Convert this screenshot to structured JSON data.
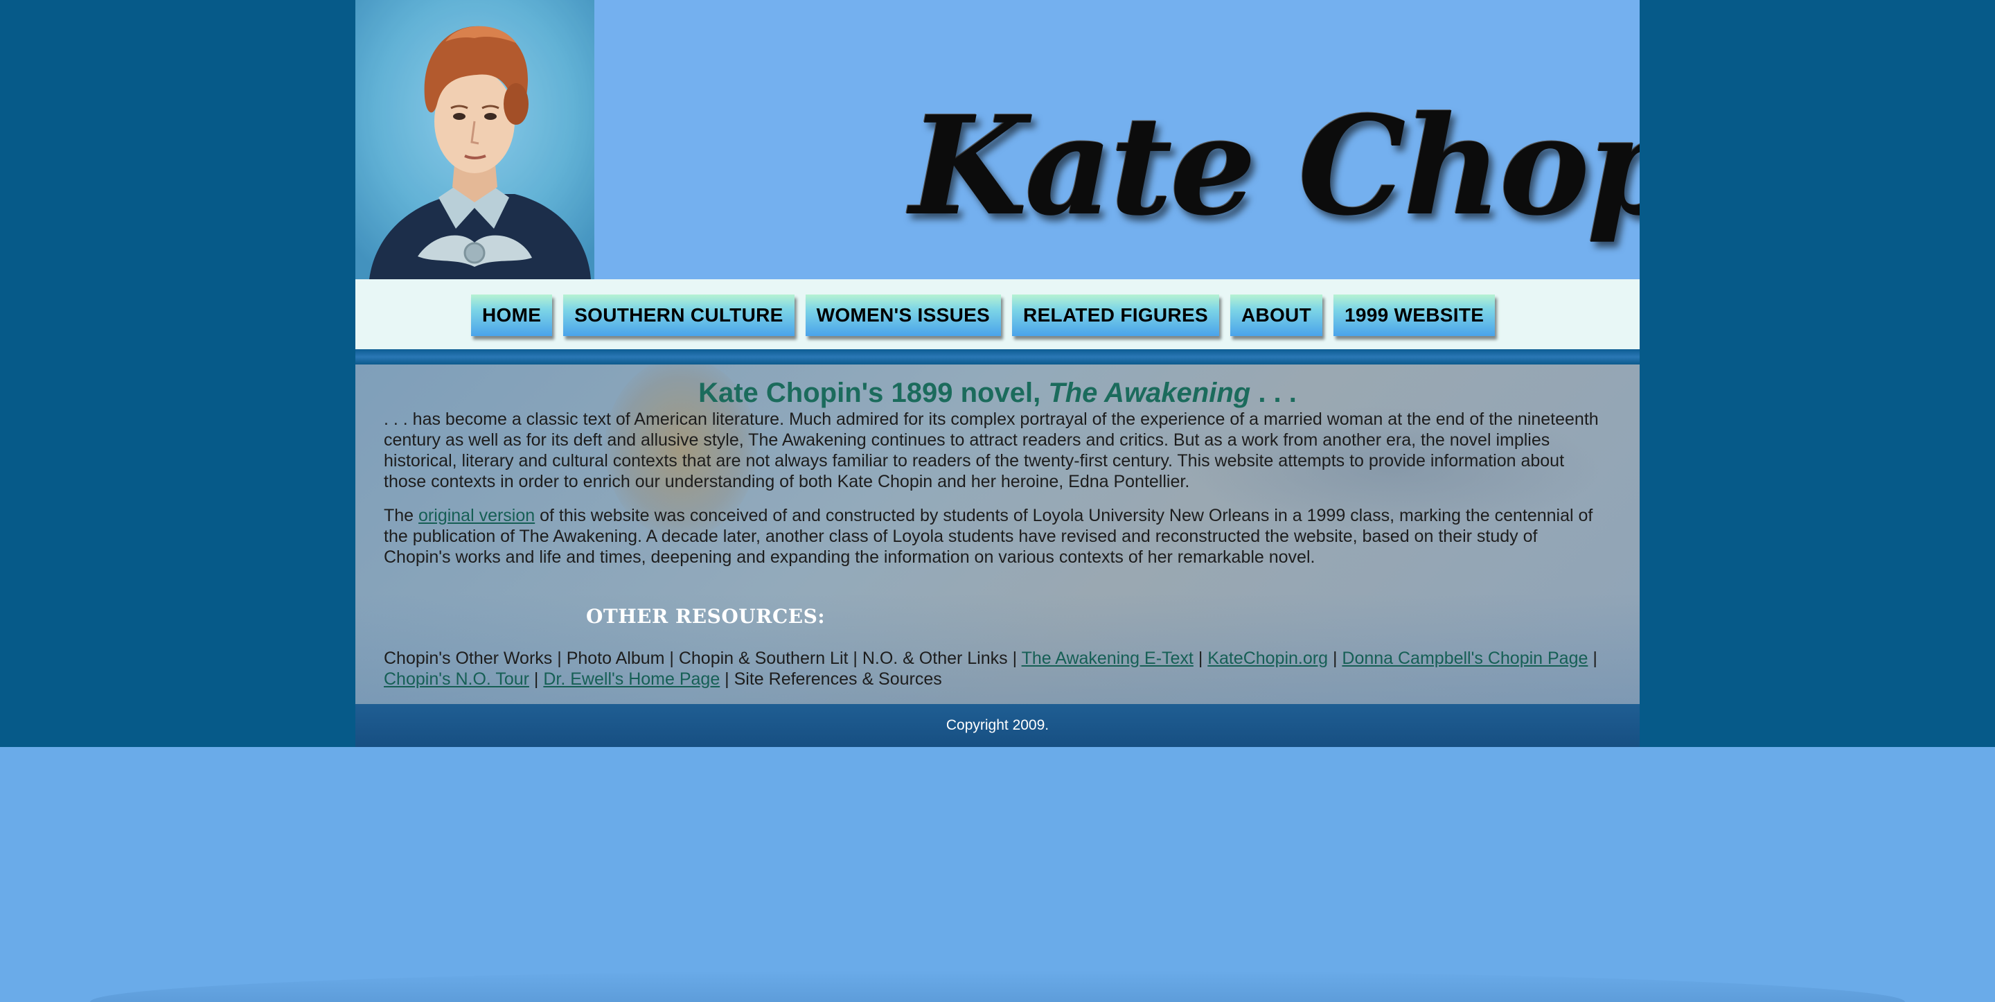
{
  "header": {
    "site_title": "Kate Chopin"
  },
  "nav": {
    "items": [
      {
        "label": "HOME"
      },
      {
        "label": "SOUTHERN CULTURE"
      },
      {
        "label": "WOMEN'S ISSUES"
      },
      {
        "label": "RELATED FIGURES"
      },
      {
        "label": "ABOUT"
      },
      {
        "label": "1999 WEBSITE"
      }
    ]
  },
  "main": {
    "headline_prefix": "Kate Chopin's 1899 novel, ",
    "headline_title": "The Awakening",
    "headline_suffix": " . . .",
    "paragraph1": ". . . has become a classic text of American literature. Much admired for its complex portrayal of the experience of a married woman at the end of the nineteenth century as well as for its deft and allusive style, The Awakening continues to attract readers and critics. But as a work from another era, the novel implies historical, literary and cultural contexts that are not always familiar to readers of the twenty-first century. This website attempts to provide information about those contexts in order to enrich our understanding of both Kate Chopin and her heroine, Edna Pontellier.",
    "paragraph2_before": "The ",
    "paragraph2_link": "original version",
    "paragraph2_after": " of this website was conceived of and constructed by students of Loyola University New Orleans in a 1999 class, marking the centennial of the publication of The Awakening. A decade later, another class of Loyola students have revised and reconstructed the website, based on their study of Chopin's works and life and times, deepening and expanding the information on various contexts of her remarkable novel.",
    "resources_heading": "OTHER RESOURCES:",
    "separator": " | ",
    "resources": [
      {
        "label": "Chopin's Other Works",
        "link": false
      },
      {
        "label": "Photo Album",
        "link": false
      },
      {
        "label": "Chopin & Southern Lit",
        "link": false
      },
      {
        "label": "N.O. & Other Links",
        "link": false
      },
      {
        "label": "The Awakening E-Text",
        "link": true
      },
      {
        "label": "KateChopin.org",
        "link": true
      },
      {
        "label": "Donna Campbell's Chopin Page",
        "link": true
      },
      {
        "label": "Chopin's N.O. Tour",
        "link": true
      },
      {
        "label": "Dr. Ewell's Home Page",
        "link": true
      },
      {
        "label": "Site References & Sources",
        "link": false
      }
    ]
  },
  "footer": {
    "copyright": "Copyright 2009."
  },
  "colors": {
    "outer_background": "#065a89",
    "lower_background": "#6aabe9",
    "header_background": "#74b0ef",
    "nav_background": "#e8f7f6",
    "headline": "#1b6b5c",
    "link": "#165f55"
  }
}
